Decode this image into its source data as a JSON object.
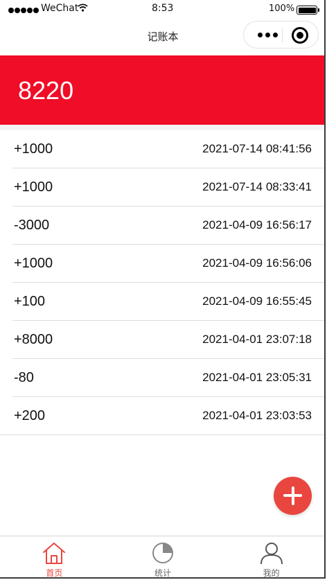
{
  "status_bar": {
    "carrier": "WeChat",
    "time": "8:53",
    "battery": "100%"
  },
  "nav": {
    "title": "记账本"
  },
  "balance": {
    "value": "8220"
  },
  "records": [
    {
      "amount": "+1000",
      "time": "2021-07-14 08:41:56"
    },
    {
      "amount": "+1000",
      "time": "2021-07-14 08:33:41"
    },
    {
      "amount": "-3000",
      "time": "2021-04-09 16:56:17"
    },
    {
      "amount": "+1000",
      "time": "2021-04-09 16:56:06"
    },
    {
      "amount": "+100",
      "time": "2021-04-09 16:55:45"
    },
    {
      "amount": "+8000",
      "time": "2021-04-01 23:07:18"
    },
    {
      "amount": "-80",
      "time": "2021-04-01 23:05:31"
    },
    {
      "amount": "+200",
      "time": "2021-04-01 23:03:53"
    }
  ],
  "tabs": [
    {
      "label": "首页",
      "icon": "home-icon",
      "active": true
    },
    {
      "label": "统计",
      "icon": "pie-chart-icon",
      "active": false
    },
    {
      "label": "我的",
      "icon": "user-icon",
      "active": false
    }
  ],
  "colors": {
    "header": "#f00d27",
    "accent": "#e9463f"
  }
}
